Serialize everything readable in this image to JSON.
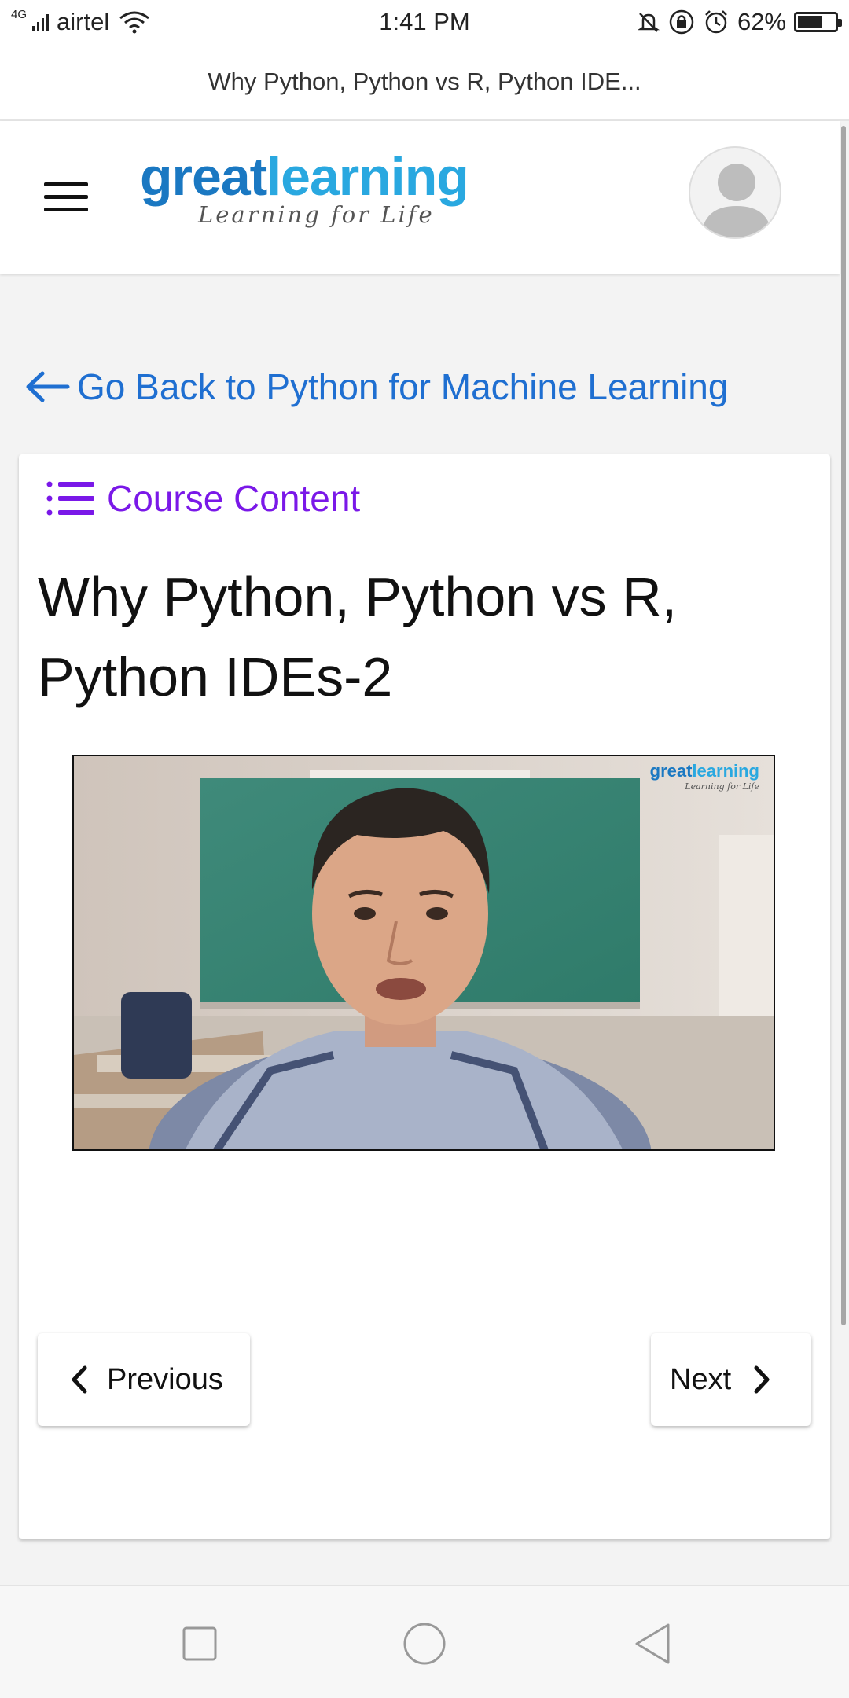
{
  "status_bar": {
    "network": "4G",
    "carrier": "airtel",
    "time": "1:41 PM",
    "battery": "62%",
    "battery_level": 0.62
  },
  "browser": {
    "page_title": "Why Python, Python vs R, Python IDE..."
  },
  "header": {
    "logo_great": "great",
    "logo_learning": "learning",
    "logo_tagline": "Learning for Life"
  },
  "back_link": {
    "label": "Go Back to Python for Machine Learning"
  },
  "course": {
    "content_label": "Course Content",
    "lesson_title_line1": "Why Python, Python vs R,",
    "lesson_title_line2": "Python IDEs-2"
  },
  "video": {
    "watermark_great": "great",
    "watermark_learning": "learning",
    "watermark_tagline": "Learning for Life"
  },
  "navigation": {
    "previous_label": "Previous",
    "next_label": "Next"
  },
  "colors": {
    "brand_blue": "#1a78c2",
    "brand_light_blue": "#29a8e0",
    "link_blue": "#1f6fd1",
    "course_purple": "#7a18e8"
  },
  "icons": [
    "signal-icon",
    "wifi-icon",
    "mute-icon",
    "lock-rotation-icon",
    "alarm-icon",
    "battery-icon",
    "hamburger-menu-icon",
    "avatar-icon",
    "back-arrow-icon",
    "list-icon",
    "chevron-left-icon",
    "chevron-right-icon",
    "recents-icon",
    "home-icon",
    "back-icon"
  ]
}
